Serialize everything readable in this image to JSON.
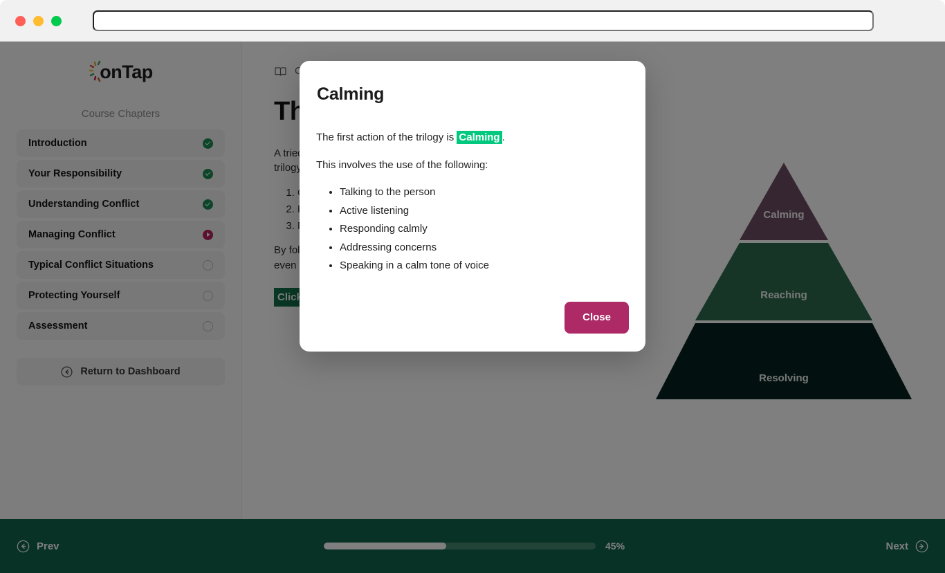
{
  "browser": {
    "url_value": "",
    "url_placeholder": "",
    "window_controls": [
      "close",
      "minimize",
      "maximize"
    ]
  },
  "sidebar": {
    "logo_text": "onTap",
    "section_label": "Course Chapters",
    "chapters": [
      {
        "label": "Introduction",
        "state": "done"
      },
      {
        "label": "Your Responsibility",
        "state": "done"
      },
      {
        "label": "Understanding Conflict",
        "state": "done"
      },
      {
        "label": "Managing Conflict",
        "state": "active"
      },
      {
        "label": "Typical Conflict Situations",
        "state": "todo"
      },
      {
        "label": "Protecting Yourself",
        "state": "todo"
      },
      {
        "label": "Assessment",
        "state": "todo"
      }
    ],
    "return_button": "Return to Dashboard"
  },
  "main": {
    "breadcrumb": "Course",
    "title": "The Trilogy",
    "paragraph_1": "A tried and tested approach to managing conflict is the trilogy. The trilogy consists of three actions:",
    "ordered_list": [
      "Calming",
      "Reaching",
      "Resolving"
    ],
    "paragraph_2": "By following these three steps you can de-escalate most situations, even when emotions are running high.",
    "click_hint": "Click on each stage of the pyramid to learn more"
  },
  "pyramid": {
    "tiers": [
      {
        "label": "Calming",
        "color": "#6d4d63"
      },
      {
        "label": "Reaching",
        "color": "#2f6b4f"
      },
      {
        "label": "Resolving",
        "color": "#04221f"
      }
    ]
  },
  "modal": {
    "title": "Calming",
    "intro_prefix": "The first action of the trilogy is ",
    "intro_keyword": "Calming",
    "intro_suffix": ".",
    "lead_in": "This involves the use of the following:",
    "items": [
      "Talking to the person",
      "Active listening",
      "Responding calmly",
      "Addressing concerns",
      "Speaking in a calm tone of voice"
    ],
    "close_label": "Close",
    "keyword_color": "#00c87e",
    "close_color": "#ad2a66"
  },
  "footer": {
    "prev_label": "Prev",
    "next_label": "Next",
    "progress_percent_label": "45%",
    "progress_value": 45,
    "bar_color": "#10644a"
  }
}
